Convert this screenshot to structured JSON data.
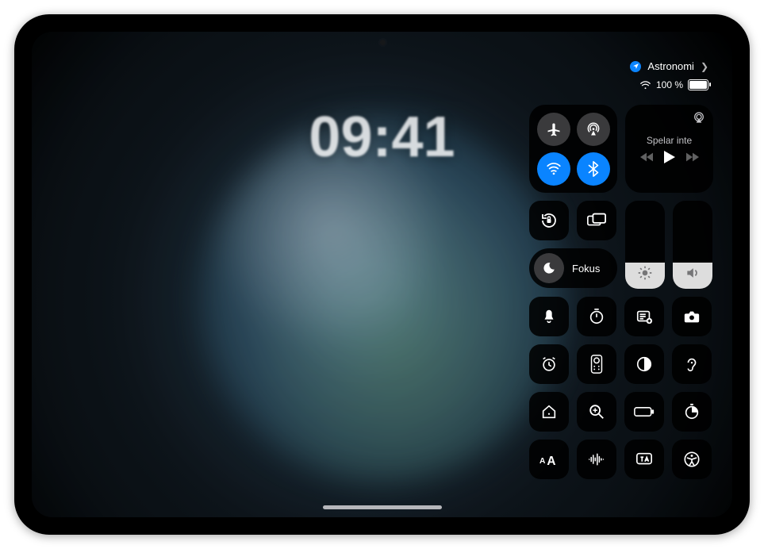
{
  "status": {
    "focus_app": "Astronomi",
    "battery_text": "100 %",
    "battery_fraction": 1.0
  },
  "lock": {
    "time": "09:41"
  },
  "connectivity": {
    "airplane": {
      "on": false,
      "name": "airplane-icon"
    },
    "airdrop": {
      "on": false,
      "name": "airdrop-icon"
    },
    "wifi": {
      "on": true,
      "name": "wifi-icon"
    },
    "bluetooth": {
      "on": true,
      "name": "bluetooth-icon"
    }
  },
  "media": {
    "status_label": "Spelar inte"
  },
  "focus": {
    "label": "Fokus"
  },
  "sliders": {
    "brightness": 0.3,
    "volume": 0.3
  },
  "small_modules": [
    [
      {
        "name": "orientation-lock-icon"
      },
      {
        "name": "screen-mirroring-icon"
      }
    ]
  ],
  "grid": [
    [
      {
        "name": "silent-mode-icon"
      },
      {
        "name": "timer-icon"
      },
      {
        "name": "quick-note-icon"
      },
      {
        "name": "camera-icon"
      }
    ],
    [
      {
        "name": "alarm-icon"
      },
      {
        "name": "apple-tv-remote-icon"
      },
      {
        "name": "dark-mode-icon"
      },
      {
        "name": "hearing-icon"
      }
    ],
    [
      {
        "name": "home-icon"
      },
      {
        "name": "magnifier-icon"
      },
      {
        "name": "low-power-icon"
      },
      {
        "name": "stopwatch-icon"
      }
    ],
    [
      {
        "name": "text-size-icon"
      },
      {
        "name": "voice-memos-icon"
      },
      {
        "name": "translate-icon"
      },
      {
        "name": "accessibility-icon"
      }
    ]
  ]
}
